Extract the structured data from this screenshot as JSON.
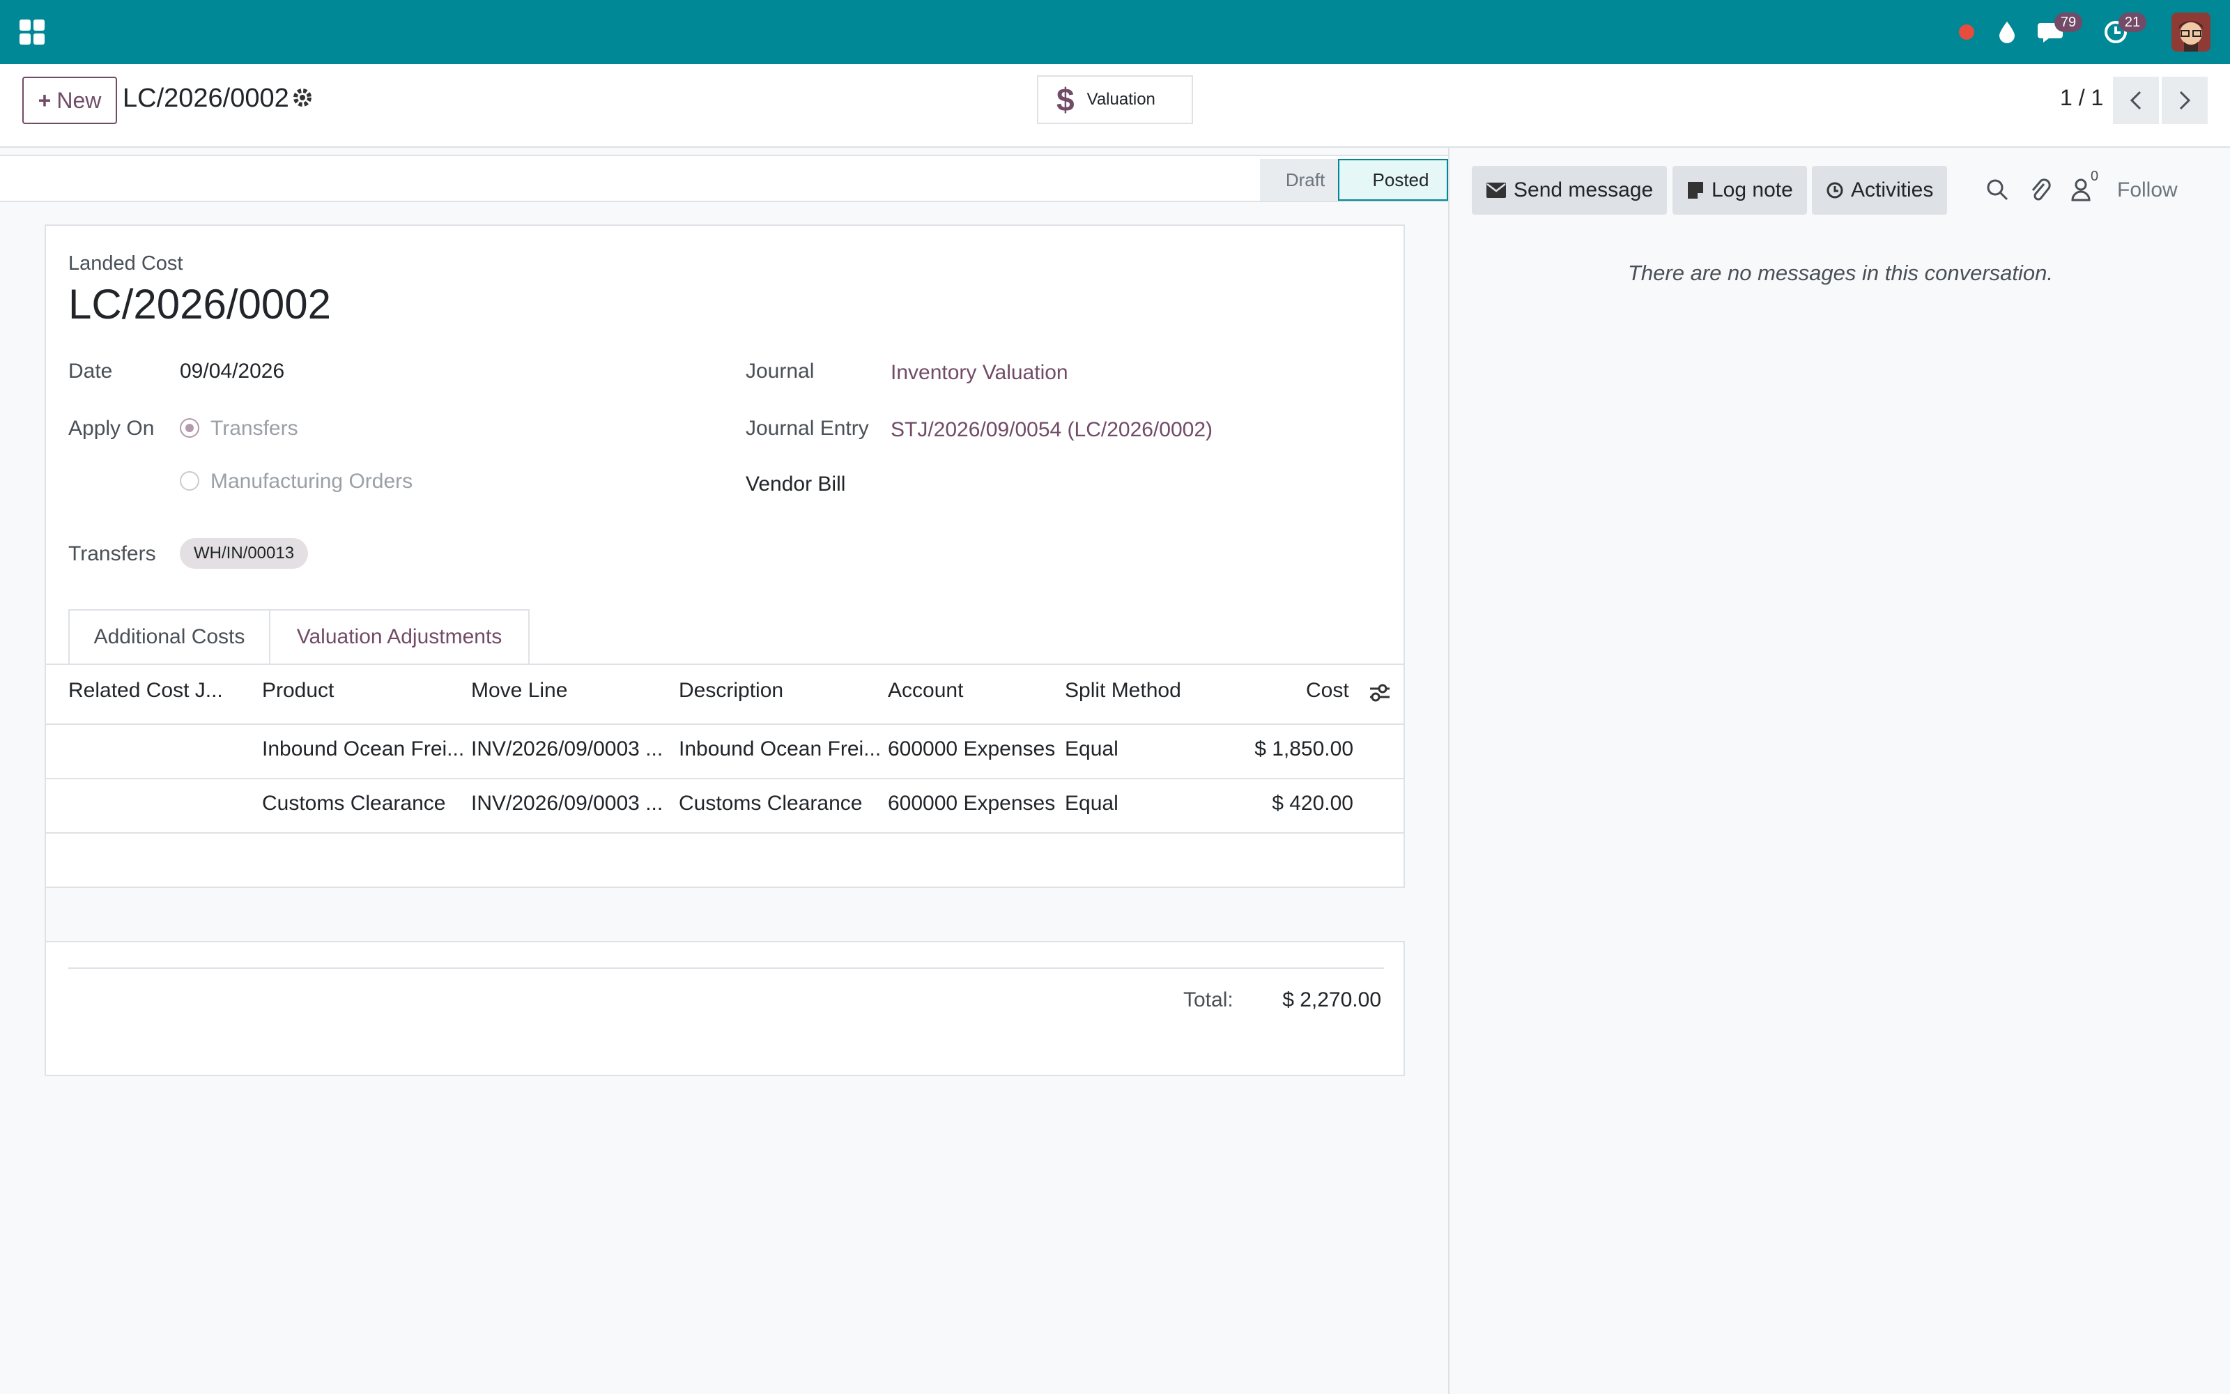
{
  "navbar": {
    "messages_count": "79",
    "activities_count": "21"
  },
  "control": {
    "new_label": "New",
    "breadcrumb": "LC/2026/0002",
    "valuation_label": "Valuation",
    "pager": "1 / 1"
  },
  "status": {
    "stages": [
      "Draft",
      "Posted"
    ],
    "current": "Posted"
  },
  "form": {
    "type_label": "Landed Cost",
    "name": "LC/2026/0002",
    "date_label": "Date",
    "date_value": "09/04/2026",
    "apply_on_label": "Apply On",
    "apply_on_options": [
      "Transfers",
      "Manufacturing Orders"
    ],
    "apply_on_selected": "Transfers",
    "transfers_label": "Transfers",
    "transfers_tags": [
      "WH/IN/00013"
    ],
    "journal_label": "Journal",
    "journal_value": "Inventory Valuation",
    "journal_entry_label": "Journal Entry",
    "journal_entry_value": "STJ/2026/09/0054 (LC/2026/0002)",
    "vendor_bill_label": "Vendor Bill",
    "vendor_bill_value": ""
  },
  "tabs": [
    {
      "label": "Additional Costs",
      "active": true
    },
    {
      "label": "Valuation Adjustments",
      "active": false
    }
  ],
  "cost_lines": {
    "columns": [
      "Related Cost J...",
      "Product",
      "Move Line",
      "Description",
      "Account",
      "Split Method",
      "Cost"
    ],
    "rows": [
      {
        "related": "",
        "product": "Inbound Ocean Frei...",
        "move_line": "INV/2026/09/0003 ...",
        "description": "Inbound Ocean Frei...",
        "account": "600000 Expenses",
        "split": "Equal",
        "cost": "$ 1,850.00"
      },
      {
        "related": "",
        "product": "Customs Clearance",
        "move_line": "INV/2026/09/0003 ...",
        "description": "Customs Clearance",
        "account": "600000 Expenses",
        "split": "Equal",
        "cost": "$ 420.00"
      }
    ],
    "total_label": "Total:",
    "total_value": "$ 2,270.00"
  },
  "chatter": {
    "send_message": "Send message",
    "log_note": "Log note",
    "activities": "Activities",
    "followers_count": "0",
    "follow_label": "Follow",
    "empty_text": "There are no messages in this conversation."
  },
  "colors": {
    "navbar": "#008896",
    "brand": "#714b67",
    "posted_border": "#008896"
  }
}
